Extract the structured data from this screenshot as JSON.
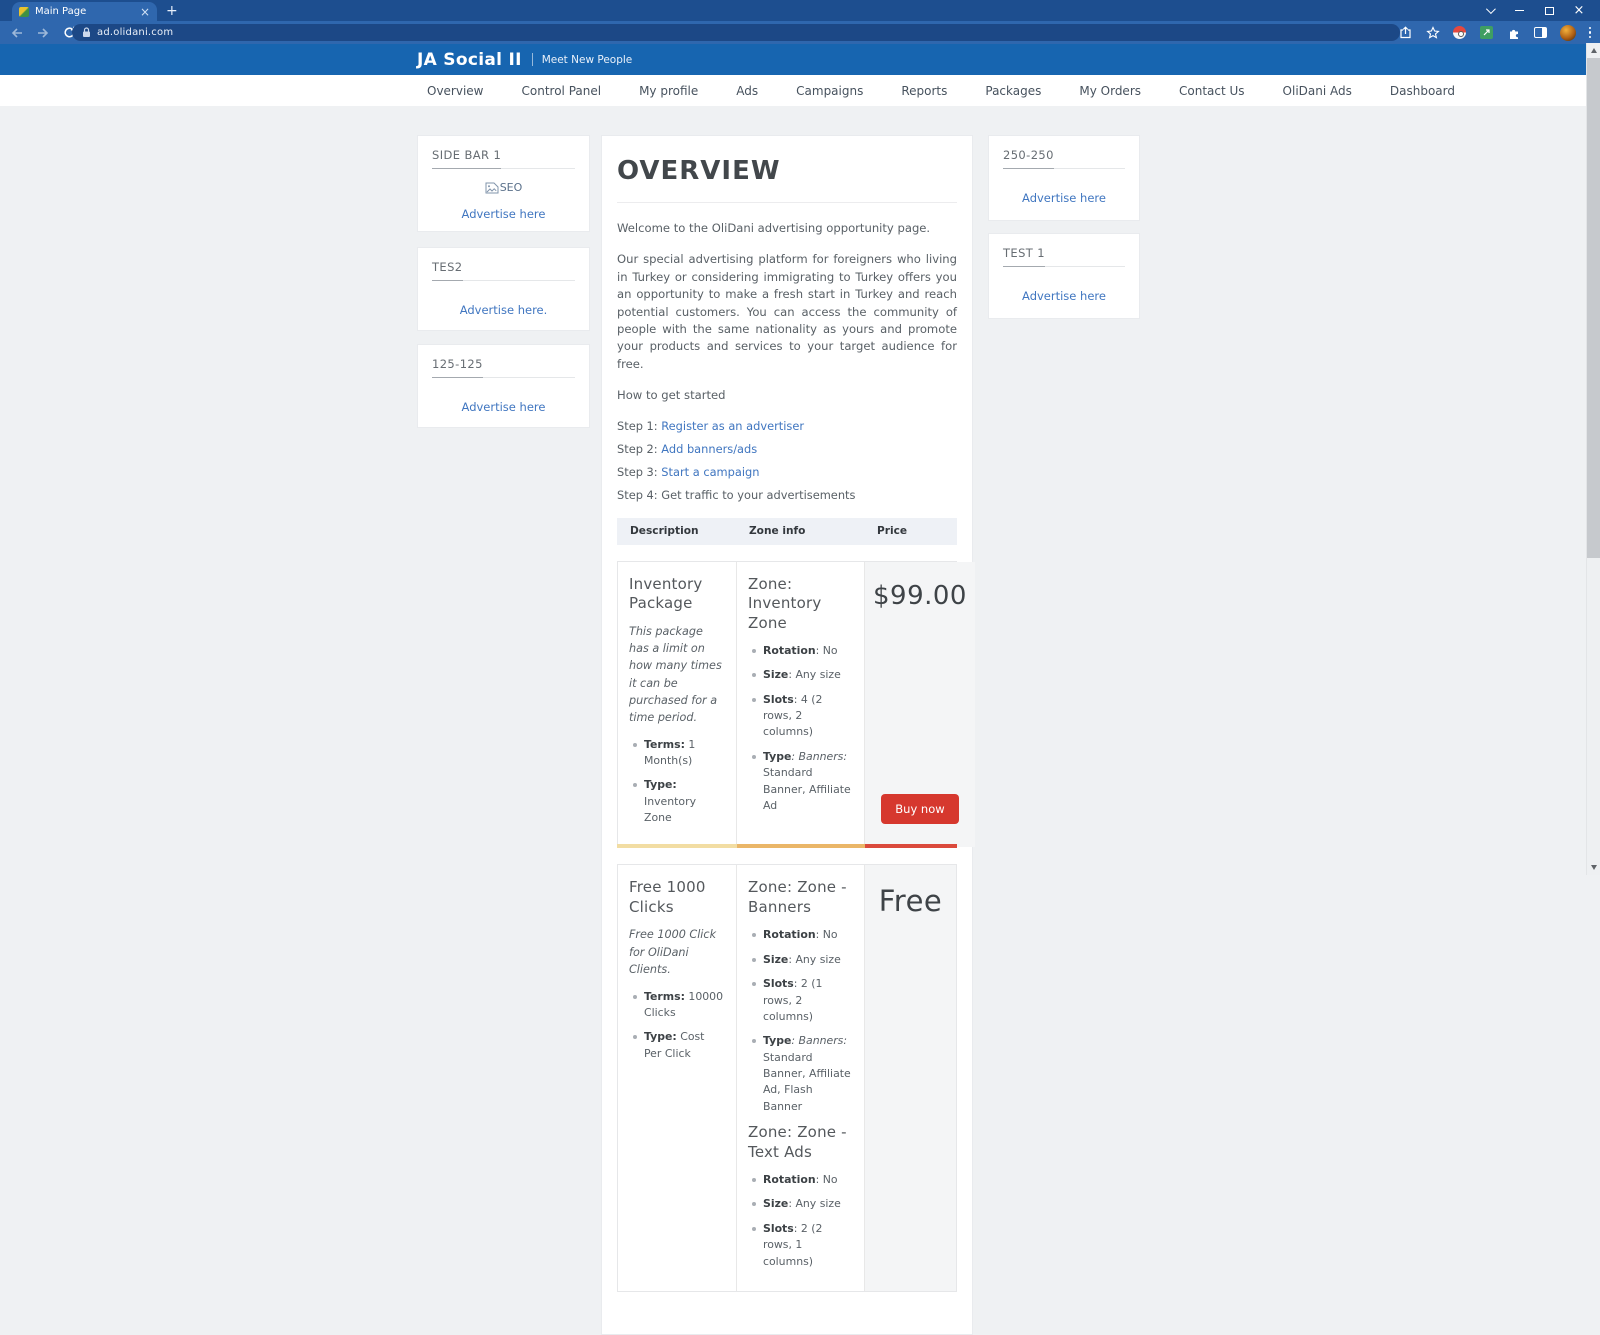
{
  "browser": {
    "tab_title": "Main Page",
    "url": "ad.olidani.com"
  },
  "header": {
    "brand": "JA Social II",
    "tagline": "Meet New People"
  },
  "nav": {
    "items": [
      "Overview",
      "Control Panel",
      "My profile",
      "Ads",
      "Campaigns",
      "Reports",
      "Packages",
      "My Orders",
      "Contact Us",
      "OliDani Ads",
      "Dashboard"
    ]
  },
  "left_sidebar": {
    "cards": [
      {
        "title": "SIDE BAR 1",
        "image_alt": "SEO",
        "link": "Advertise here"
      },
      {
        "title": "TES2",
        "link": "Advertise here."
      },
      {
        "title": "125-125",
        "link": "Advertise here"
      }
    ]
  },
  "right_sidebar": {
    "cards": [
      {
        "title": "250-250",
        "link": "Advertise here"
      },
      {
        "title": "TEST 1",
        "link": "Advertise here"
      }
    ]
  },
  "main": {
    "title": "OVERVIEW",
    "p1": "Welcome to the OliDani advertising opportunity page.",
    "p2": "Our special advertising platform for foreigners who living in Turkey or considering immigrating to Turkey offers you an opportunity to make a fresh start in Turkey and reach potential customers. You can access the community of people with the same nationality as yours and promote your products and services to your target audience for free.",
    "how_to": "How to get started",
    "steps": [
      {
        "prefix": "Step 1: ",
        "link": "Register as an advertiser"
      },
      {
        "prefix": "Step 2: ",
        "link": "Add banners/ads"
      },
      {
        "prefix": "Step 3: ",
        "link": "Start a campaign"
      },
      {
        "prefix": "Step 4: Get traffic to your advertisements",
        "link": ""
      }
    ],
    "table": {
      "headers": [
        "Description",
        "Zone info",
        "Price"
      ],
      "row1": {
        "title": "Inventory Package",
        "note": "This package has a limit on how many times it can be purchased for a time period.",
        "terms_label": "Terms:",
        "terms_value": " 1 Month(s)",
        "type_label": "Type:",
        "type_value": " Inventory Zone",
        "zone_title": "Zone: Inventory Zone",
        "rotation_label": "Rotation",
        "rotation_value": ": No",
        "size_label": "Size",
        "size_value": ": Any size",
        "slots_label": "Slots",
        "slots_value": ": 4 (2 rows, 2 columns)",
        "ztype_label": "Type",
        "ztype_em": ": Banners:",
        "ztype_value": " Standard Banner, Affiliate Ad",
        "price": "$99.00",
        "buy_label": "Buy now"
      },
      "row2": {
        "title": "Free 1000 Clicks",
        "note": "Free 1000 Click for OliDani Clients.",
        "terms_label": "Terms:",
        "terms_value": " 10000 Clicks",
        "type_label": "Type:",
        "type_value": " Cost Per Click",
        "zone1_title": "Zone: Zone - Banners",
        "z1_rotation_label": "Rotation",
        "z1_rotation_value": ": No",
        "z1_size_label": "Size",
        "z1_size_value": ": Any size",
        "z1_slots_label": "Slots",
        "z1_slots_value": ": 2 (1 rows, 2 columns)",
        "z1_type_label": "Type",
        "z1_type_em": ": Banners:",
        "z1_type_value": " Standard Banner, Affiliate Ad, Flash Banner",
        "zone2_title": "Zone: Zone - Text Ads",
        "z2_rotation_label": "Rotation",
        "z2_rotation_value": ": No",
        "z2_size_label": "Size",
        "z2_size_value": ": Any size",
        "z2_slots_label": "Slots",
        "z2_slots_value": ": 2 (2 rows, 1 columns)",
        "price": "Free"
      }
    }
  },
  "colors": {
    "titlebar_blue": "#1d4e8f",
    "toolbar_blue": "#2f67ae",
    "site_header_blue": "#1765b0",
    "link_blue": "#4076c0",
    "buy_red": "#d6382e",
    "stripe_yellow": "#f2dda3",
    "stripe_orange": "#eab668",
    "stripe_red": "#db4a3c"
  }
}
